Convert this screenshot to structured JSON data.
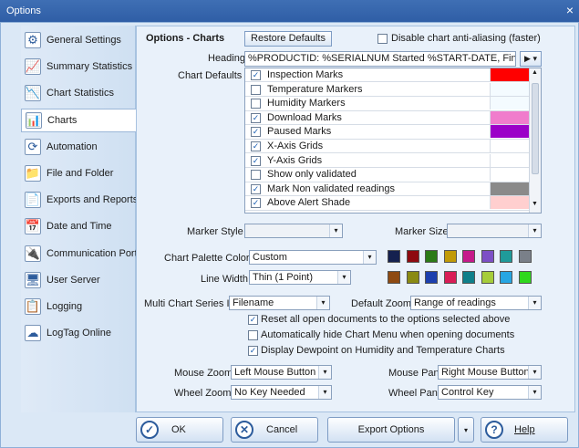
{
  "window": {
    "title": "Options",
    "close": "×"
  },
  "sidebar": {
    "items": [
      {
        "label": "General Settings",
        "icon": "general-settings-icon"
      },
      {
        "label": "Summary Statistics",
        "icon": "summary-statistics-icon"
      },
      {
        "label": "Chart Statistics",
        "icon": "chart-statistics-icon"
      },
      {
        "label": "Charts",
        "icon": "charts-icon",
        "selected": true
      },
      {
        "label": "Automation",
        "icon": "automation-icon"
      },
      {
        "label": "File and Folder",
        "icon": "folder-icon"
      },
      {
        "label": "Exports and Reports",
        "icon": "exports-icon"
      },
      {
        "label": "Date and Time",
        "icon": "calendar-icon"
      },
      {
        "label": "Communication Ports",
        "icon": "usb-icon"
      },
      {
        "label": "User Server",
        "icon": "server-icon"
      },
      {
        "label": "Logging",
        "icon": "logging-icon"
      },
      {
        "label": "LogTag Online",
        "icon": "online-icon"
      }
    ]
  },
  "panel": {
    "title": "Options - Charts",
    "restore_defaults": "Restore Defaults",
    "disable_antialias": "Disable chart anti-aliasing (faster)",
    "disable_antialias_checked": false,
    "heading_label": "Heading",
    "heading_value": "%PRODUCTID: %SERIALNUM Started %START-DATE, Finished %FINISH",
    "chart_defaults_label": "Chart Defaults",
    "chart_defaults": [
      {
        "label": "Inspection Marks",
        "checked": true,
        "color": "#ff0000"
      },
      {
        "label": "Temperature Markers",
        "checked": false,
        "color": "#f4fbff"
      },
      {
        "label": "Humidity Markers",
        "checked": false,
        "color": "#f4fbff"
      },
      {
        "label": "Download Marks",
        "checked": true,
        "color": "#f07ccc"
      },
      {
        "label": "Paused Marks",
        "checked": true,
        "color": "#9b00c8"
      },
      {
        "label": "X-Axis Grids",
        "checked": true,
        "color": ""
      },
      {
        "label": "Y-Axis Grids",
        "checked": true,
        "color": ""
      },
      {
        "label": "Show only validated",
        "checked": false,
        "color": ""
      },
      {
        "label": "Mark Non validated readings",
        "checked": true,
        "color": "#8a8a8a"
      },
      {
        "label": "Above Alert Shade",
        "checked": true,
        "color": "#ffcfcf"
      }
    ],
    "marker_style_label": "Marker Style",
    "marker_size_label": "Marker Size",
    "palette_label": "Chart Palette Colors",
    "palette_value": "Custom",
    "palette_row1": [
      "#15214f",
      "#8e0a10",
      "#2c7a16",
      "#c19a07",
      "#c61a8b",
      "#7d4fc6",
      "#1f9b9a",
      "#7a8089"
    ],
    "palette_row2": [
      "#8e4a12",
      "#8a8a12",
      "#1c3fae",
      "#d81d56",
      "#0e7f8a",
      "#a6cd3a",
      "#27a6e3",
      "#2fd81d"
    ],
    "line_width_label": "Line Width",
    "line_width_value": "Thin (1 Point)",
    "multi_series_label": "Multi Chart Series ID:",
    "multi_series_value": "Filename",
    "default_zoom_label": "Default Zoom:",
    "default_zoom_value": "Range of readings",
    "opt_reset": "Reset all open documents to the options selected above",
    "opt_reset_checked": true,
    "opt_autohide": "Automatically hide Chart Menu when opening documents",
    "opt_autohide_checked": false,
    "opt_dewpoint": "Display Dewpoint on Humidity and Temperature Charts",
    "opt_dewpoint_checked": true,
    "mouse_zoom_label": "Mouse Zoom:",
    "mouse_zoom_value": "Left Mouse Button",
    "mouse_pan_label": "Mouse Pan:",
    "mouse_pan_value": "Right Mouse Button",
    "wheel_zoom_label": "Wheel Zoom:",
    "wheel_zoom_value": "No Key Needed",
    "wheel_pan_label": "Wheel Pan:",
    "wheel_pan_value": "Control Key"
  },
  "footer": {
    "ok": "OK",
    "cancel": "Cancel",
    "export_options": "Export Options",
    "help": "Help"
  }
}
